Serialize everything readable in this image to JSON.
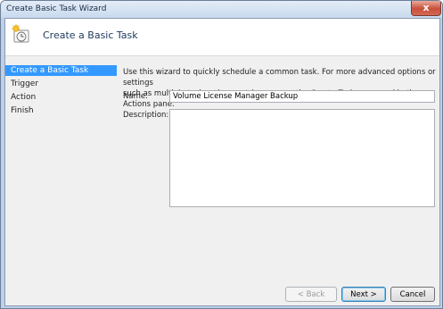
{
  "window": {
    "title": "Create Basic Task Wizard",
    "close_glyph": "x"
  },
  "header": {
    "title": "Create a Basic Task",
    "icon": "task-clock-icon"
  },
  "nav": {
    "items": [
      {
        "label": "Create a Basic Task",
        "selected": true
      },
      {
        "label": "Trigger",
        "selected": false
      },
      {
        "label": "Action",
        "selected": false
      },
      {
        "label": "Finish",
        "selected": false
      }
    ]
  },
  "main": {
    "intro_line1": "Use this wizard to quickly schedule a common task.  For more advanced options or settings",
    "intro_line2": "such as multiple task actions or triggers, use the Create Task command in the Actions pane.",
    "name_label": "Name:",
    "name_value": "Volume License Manager Backup",
    "description_label": "Description:",
    "description_value": ""
  },
  "buttons": {
    "back": "< Back",
    "next": "Next >",
    "cancel": "Cancel"
  },
  "colors": {
    "selection": "#3399ff",
    "header_title": "#1e395b"
  }
}
